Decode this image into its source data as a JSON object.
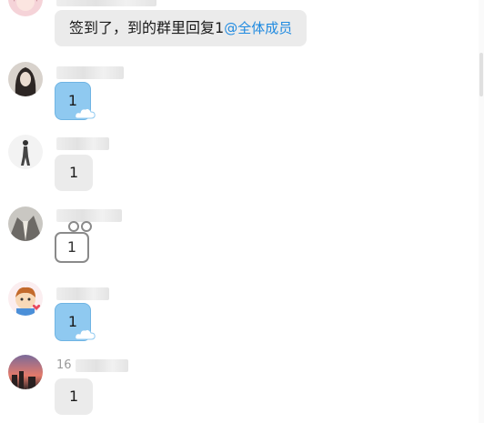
{
  "messages": [
    {
      "id": "m1",
      "sender_visible": "",
      "text": "签到了，到的群里回复1",
      "mention": "@全体成员",
      "bubble": "gray"
    },
    {
      "id": "m2",
      "sender_visible": "",
      "text": "1",
      "bubble": "blue"
    },
    {
      "id": "m3",
      "sender_visible": "",
      "text": "1",
      "bubble": "gray"
    },
    {
      "id": "m4",
      "sender_visible": "",
      "text": "1",
      "bubble": "frame"
    },
    {
      "id": "m5",
      "sender_visible": "",
      "text": "1",
      "bubble": "blue"
    },
    {
      "id": "m6",
      "sender_visible": "16",
      "text": "1",
      "bubble": "gray"
    }
  ],
  "icons": {
    "avatars": [
      "avatar-pink-girl",
      "avatar-dark-hair-girl",
      "avatar-runner",
      "avatar-suit",
      "avatar-cartoon-boy",
      "avatar-sunset"
    ],
    "cloud": "cloud-decoration-icon",
    "frame_ears": "frame-ears-icon"
  },
  "colors": {
    "mention": "#1f8ae0",
    "bubble_gray": "#ebebeb",
    "bubble_blue": "#8fc9f0"
  }
}
